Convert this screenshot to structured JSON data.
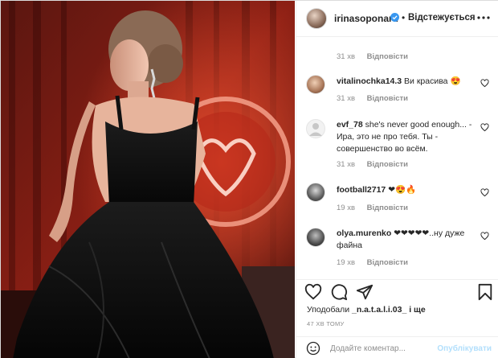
{
  "post": {
    "photo_alt": "",
    "author": "irinasoponaru",
    "follow_state": "Відстежується",
    "separator": "•"
  },
  "comments": [
    {
      "user": "",
      "text": "",
      "time": "31 хв",
      "reply": "Відповісти"
    },
    {
      "user": "vitalinochka14.3",
      "text": "Ви красива 😍",
      "time": "31 хв",
      "reply": "Відповісти"
    },
    {
      "user": "evf_78",
      "text": "she's never good enough... - Ира, это не про тебя. Ты - совершенство во всём.",
      "time": "31 хв",
      "reply": "Відповісти"
    },
    {
      "user": "football2717",
      "text": "❤😍🔥",
      "time": "19 хв",
      "reply": "Відповісти"
    },
    {
      "user": "olya.murenko",
      "text": "❤❤❤❤❤..ну дуже файна",
      "time": "19 хв",
      "reply": "Відповісти"
    }
  ],
  "actions": {
    "liked_by_prefix": "Уподобали",
    "liked_by_user": "_n.a.t.a.l.i.03_",
    "liked_by_suffix": "і ще",
    "posted_ago": "47 ХВ ТОМУ"
  },
  "add_comment": {
    "placeholder": "Додайте коментар...",
    "publish_label": "Опублікувати"
  },
  "colors": {
    "accent_blue": "#0095f6",
    "verified_blue": "#3897f0",
    "muted": "#8e8e8e",
    "heart_red": "#ed4956"
  }
}
